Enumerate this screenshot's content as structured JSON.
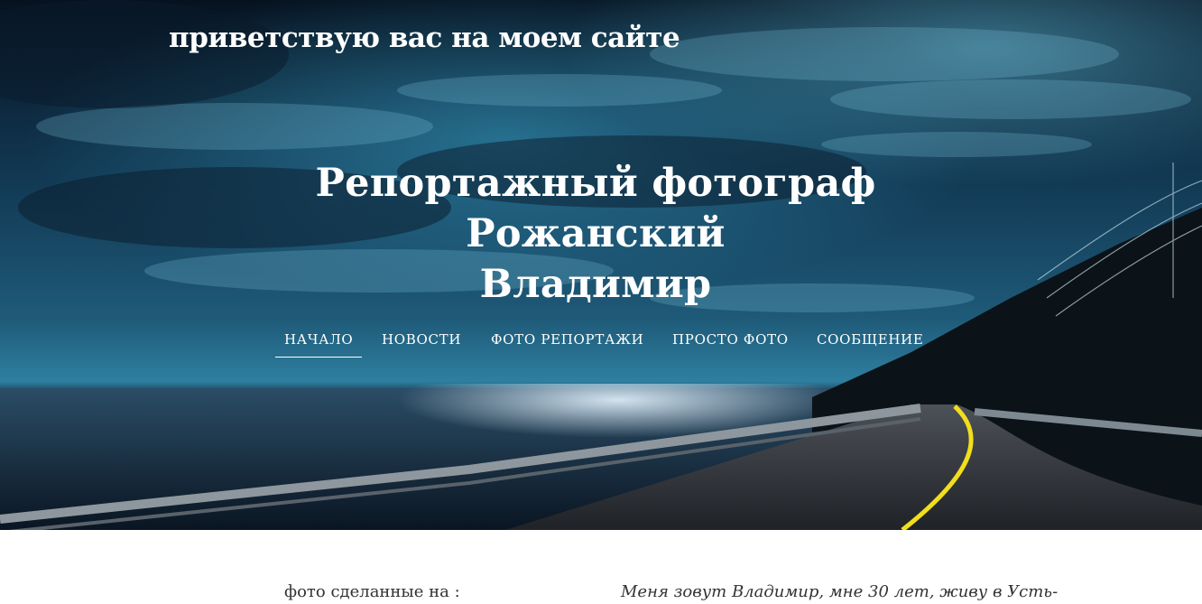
{
  "header": {
    "tagline": "приветствую вас на моем сайте",
    "title_lines": [
      "Репортажный фотограф",
      "Рожанский",
      "Владимир"
    ],
    "background": "night-coastal-road-photo"
  },
  "nav": {
    "items": [
      {
        "label": "НАЧАЛО",
        "active": true
      },
      {
        "label": "НОВОСТИ",
        "active": false
      },
      {
        "label": "ФОТО РЕПОРТАЖИ",
        "active": false
      },
      {
        "label": "ПРОСТО ФОТО",
        "active": false
      },
      {
        "label": "СООБЩЕНИЕ",
        "active": false
      }
    ]
  },
  "content": {
    "left_text": "фото сделанные на :",
    "right_text": "Меня зовут  Владимир, мне 30 лет, живу в Усть-"
  },
  "colors": {
    "sky_dark": "#071423",
    "sky_light": "#2f7fa0",
    "sea": "#1b2b3c",
    "road": "#3a3d42",
    "road_line": "#f2de1c",
    "text_light": "#ffffff",
    "text_dark": "#333333"
  }
}
